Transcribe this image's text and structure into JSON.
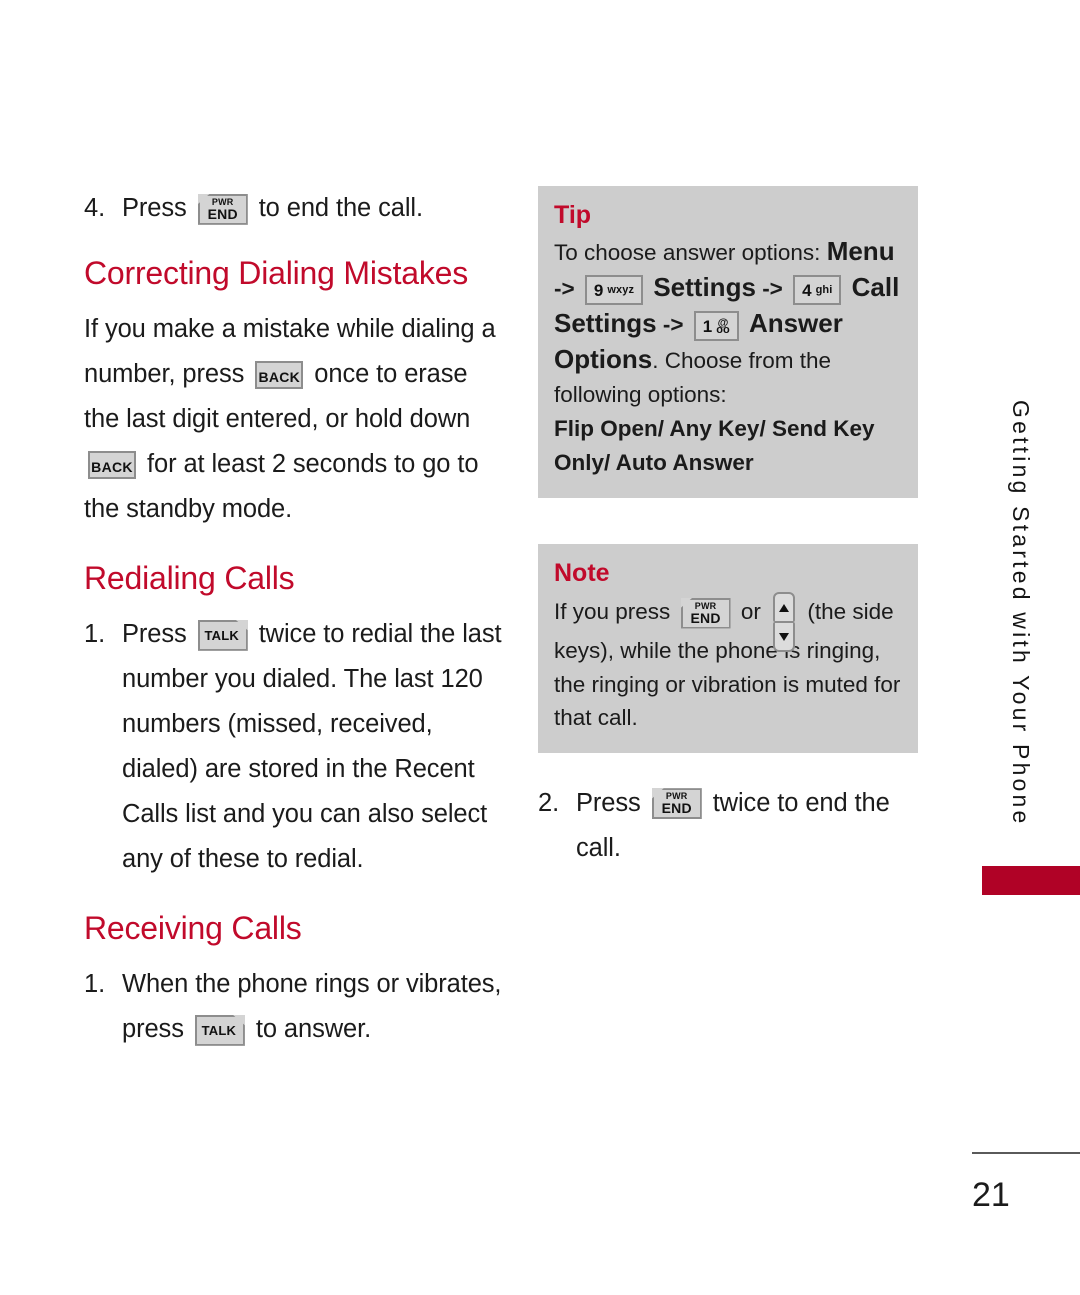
{
  "page": {
    "number": "21",
    "running_head": "Getting Started with Your Phone",
    "accent_red": "#C10A2B",
    "tab_red": "#B00226",
    "callout_gray": "#CDCDCD"
  },
  "keys": {
    "end": {
      "top_label": "PWR",
      "bottom_label": "END",
      "name": "pwr-end-key"
    },
    "talk": {
      "label": "TALK",
      "name": "talk-key"
    },
    "back": {
      "label": "BACK",
      "name": "back-key"
    },
    "num9": {
      "digit": "9",
      "letters": "wxyz"
    },
    "num4": {
      "digit": "4",
      "letters": "ghi"
    },
    "num1": {
      "digit": "1",
      "letters": "@"
    },
    "side": {
      "up": "▲",
      "down": "▼"
    }
  },
  "left_column": {
    "step4": {
      "number": "4.",
      "text_before": "Press",
      "text_after": "to end the call."
    },
    "heading_correcting": "Correcting Dialing Mistakes",
    "correcting_body": {
      "part1": "If you make a mistake while dialing a number, press",
      "part2": "once to erase the last digit entered, or hold down",
      "part3": "for at least 2 seconds to go to the standby mode."
    },
    "heading_redialing": "Redialing Calls",
    "redial_step1": {
      "number": "1.",
      "text_before": "Press",
      "text_after": "twice to redial the last number you dialed. The last 120 numbers (missed, received, dialed) are stored in the Recent Calls list and you can also select any of these to redial."
    },
    "heading_receiving": "Receiving Calls",
    "receiving_step1": {
      "number": "1.",
      "text_before": "When the phone rings or vibrates, press",
      "text_after": "to answer."
    }
  },
  "right_column": {
    "tip": {
      "title": "Tip",
      "line1": "To choose answer options:",
      "menu": "Menu",
      "arrow": "->",
      "settings1": "Settings",
      "call": "Call",
      "settings2": "Settings",
      "answer_options": "Answer Options",
      "after_answer_options": ". Choose from the following options:",
      "options": "Flip Open/ Any Key/ Send Key Only/ Auto Answer"
    },
    "note": {
      "title": "Note",
      "part1": "If you press",
      "part2": "or",
      "part3": "(the side keys), while the phone is ringing, the ringing or vibration is muted for that call."
    },
    "step2": {
      "number": "2.",
      "text_before": "Press",
      "text_after": "twice to end the call."
    }
  }
}
